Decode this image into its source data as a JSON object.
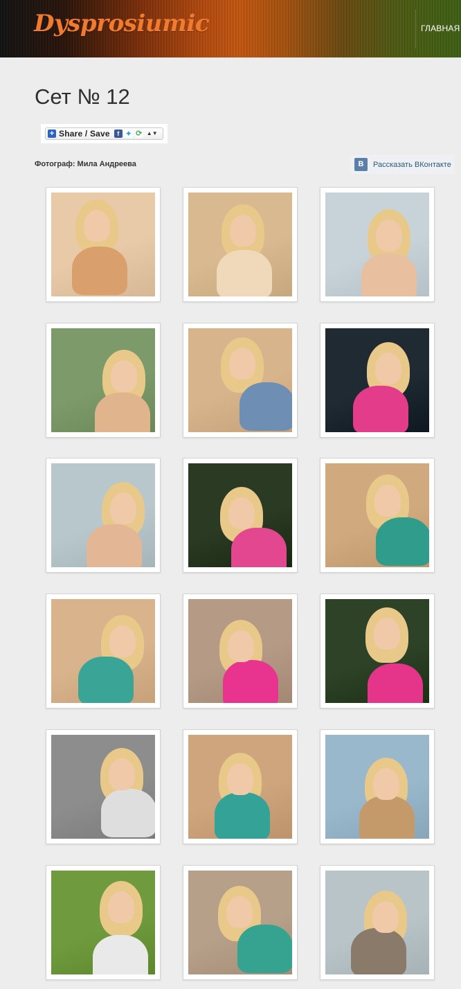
{
  "header": {
    "logo": "Dysprosiumic",
    "nav": {
      "home_label": "ГЛАВНАЯ"
    }
  },
  "page": {
    "title": "Сет № 12",
    "photographer": "Фотограф: Мила Андреева"
  },
  "share": {
    "label": "Share / Save",
    "icons": [
      "plus-icon",
      "facebook-icon",
      "twitter-icon",
      "share-more-icon",
      "caret-icon"
    ]
  },
  "vk": {
    "label": "Рассказать ВКонтакте",
    "icon": "vk-icon",
    "brand_color": "#5b7fa6"
  },
  "colors": {
    "logo": "#f07a2e",
    "background": "#ededed",
    "link": "#2b587a"
  },
  "gallery": {
    "columns": 3,
    "rows": 6,
    "photos": [
      {
        "bg": "#e8c9a8",
        "accent": "#d9a06e"
      },
      {
        "bg": "#d9b98f",
        "accent": "#f0d9bb"
      },
      {
        "bg": "#c7d3d9",
        "accent": "#e8c0a0"
      },
      {
        "bg": "#7d9a6a",
        "accent": "#e0b48c"
      },
      {
        "bg": "#d7b48c",
        "accent": "#6f8eb3"
      },
      {
        "bg": "#1f2a33",
        "accent": "#e23c8a"
      },
      {
        "bg": "#b8c7cc",
        "accent": "#e3b795"
      },
      {
        "bg": "#2b3a22",
        "accent": "#e2478f"
      },
      {
        "bg": "#d1a97f",
        "accent": "#2f9c8c"
      },
      {
        "bg": "#d8b38c",
        "accent": "#3aa597"
      },
      {
        "bg": "#b59a86",
        "accent": "#e8348f"
      },
      {
        "bg": "#2d4226",
        "accent": "#e5358a"
      },
      {
        "bg": "#8d8d8d",
        "accent": "#dedede"
      },
      {
        "bg": "#cfa57e",
        "accent": "#34a297"
      },
      {
        "bg": "#9ab8cc",
        "accent": "#c49a6a"
      },
      {
        "bg": "#6f9a3e",
        "accent": "#e9e9e9"
      },
      {
        "bg": "#b7a08a",
        "accent": "#35a38f"
      },
      {
        "bg": "#b9c4c8",
        "accent": "#8a7a6a"
      }
    ]
  }
}
